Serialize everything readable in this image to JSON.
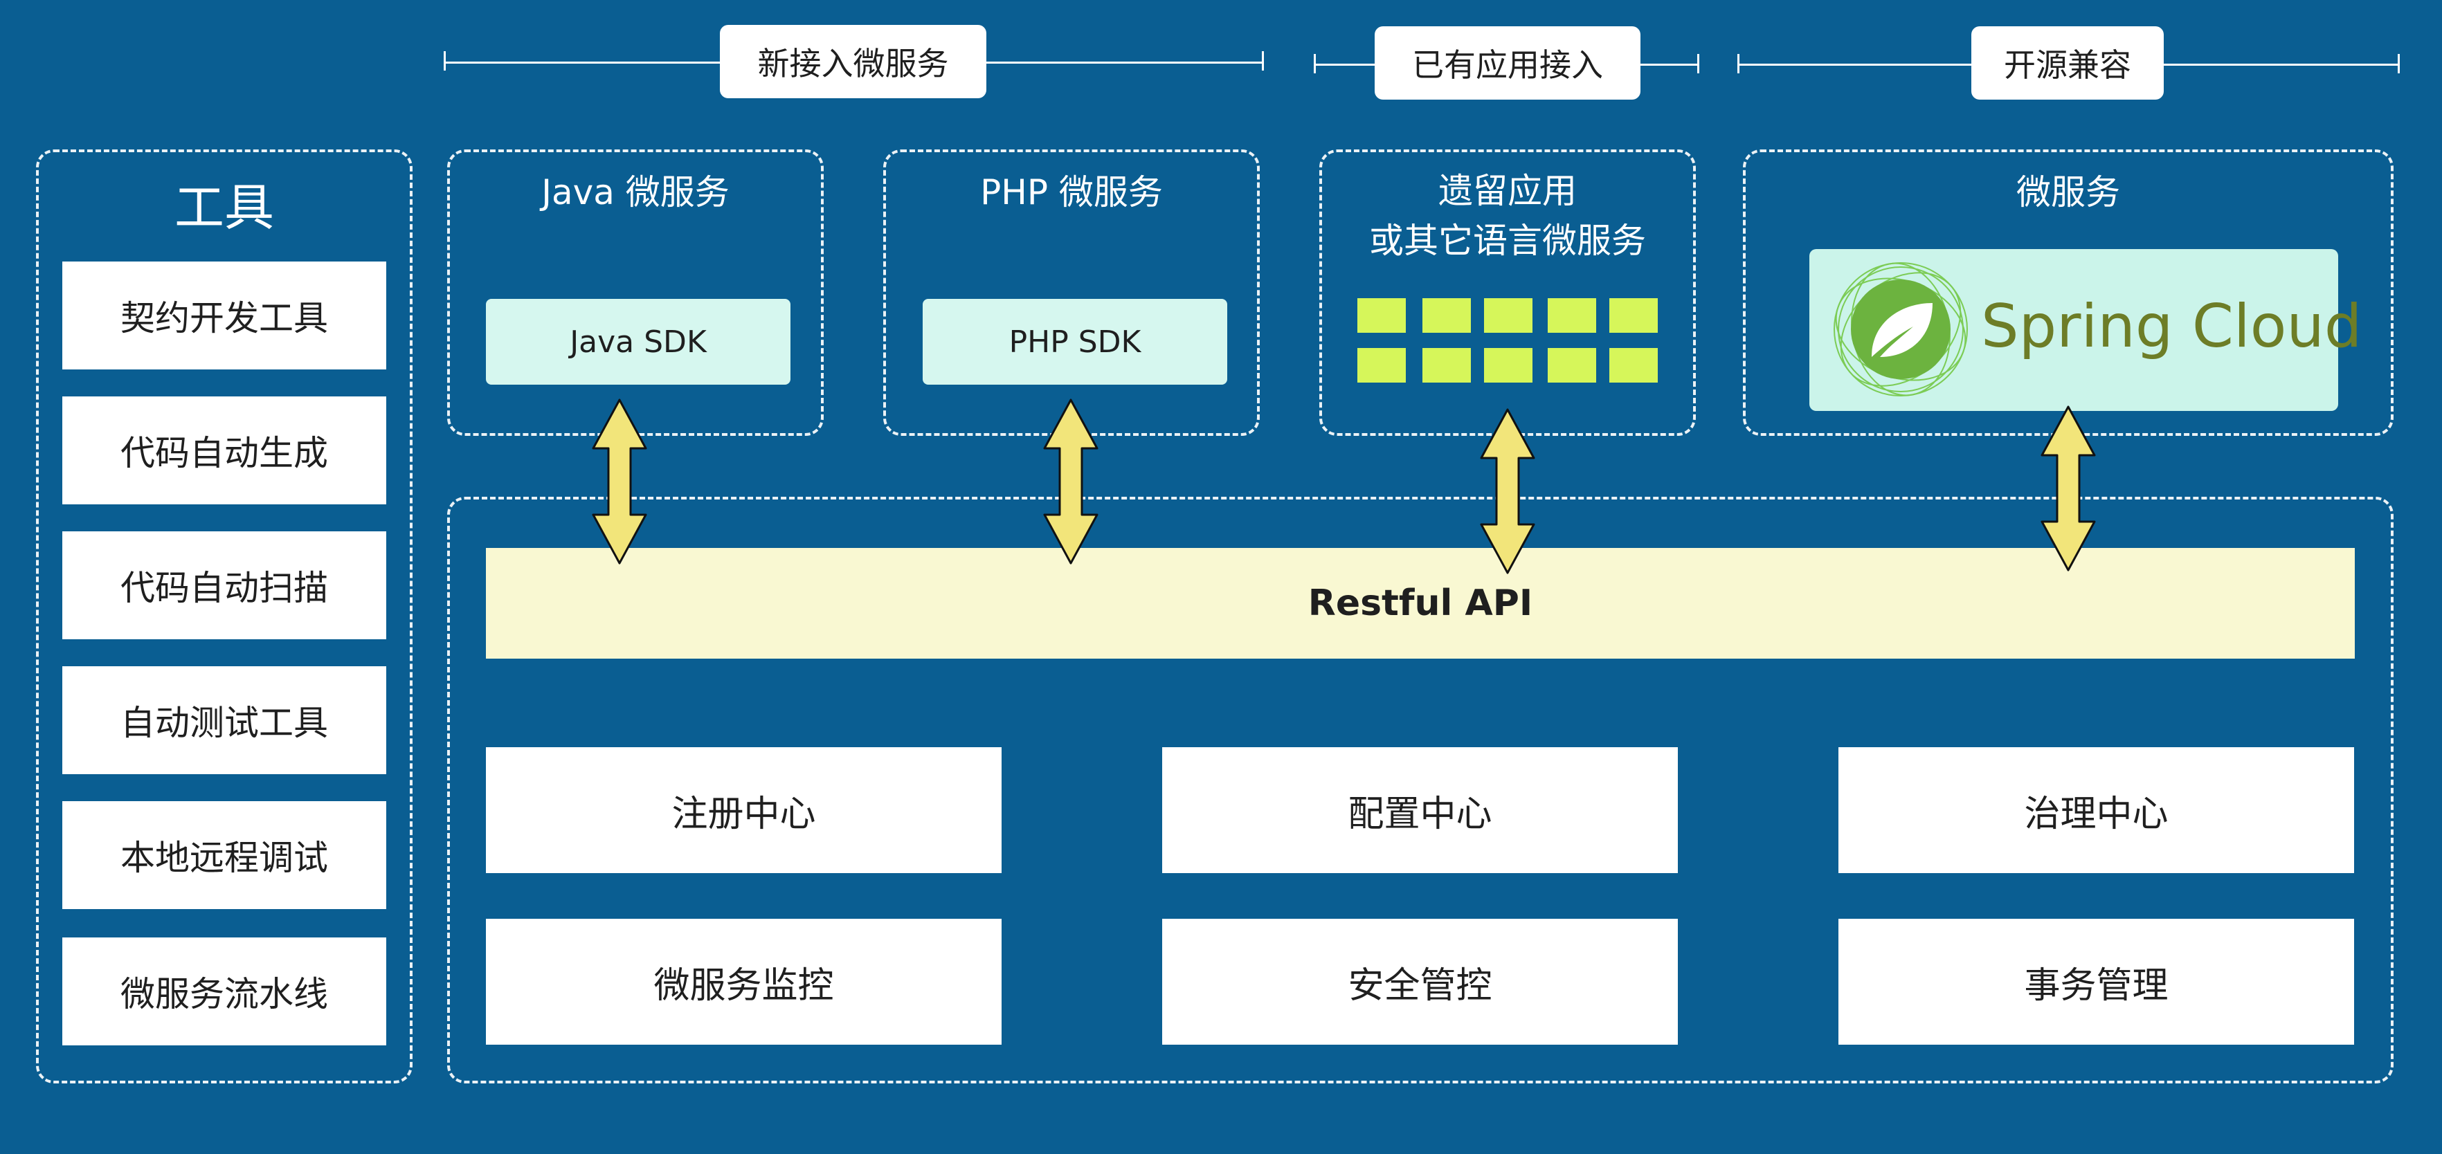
{
  "headers": {
    "new_services": "新接入微服务",
    "existing_apps": "已有应用接入",
    "open_source": "开源兼容"
  },
  "tools": {
    "title": "工具",
    "items": [
      "契约开发工具",
      "代码自动生成",
      "代码自动扫描",
      "自动测试工具",
      "本地远程调试",
      "微服务流水线"
    ]
  },
  "java": {
    "title": "Java 微服务",
    "sdk": "Java SDK"
  },
  "php": {
    "title": "PHP 微服务",
    "sdk": "PHP SDK"
  },
  "legacy": {
    "title_line1": "遗留应用",
    "title_line2": "或其它语言微服务"
  },
  "microservice": {
    "title": "微服务",
    "spring_label": "Spring Cloud"
  },
  "api": {
    "label": "Restful API"
  },
  "services": {
    "registry": "注册中心",
    "config": "配置中心",
    "governance": "治理中心",
    "monitoring": "微服务监控",
    "security": "安全管控",
    "transaction": "事务管理"
  },
  "colors": {
    "background": "#0a5e92",
    "sdk": "#d6f7ef",
    "api": "#f9f8d2",
    "grid": "#d6f65a",
    "arrow": "#f2e57a",
    "spring_text": "#6d7d27"
  }
}
